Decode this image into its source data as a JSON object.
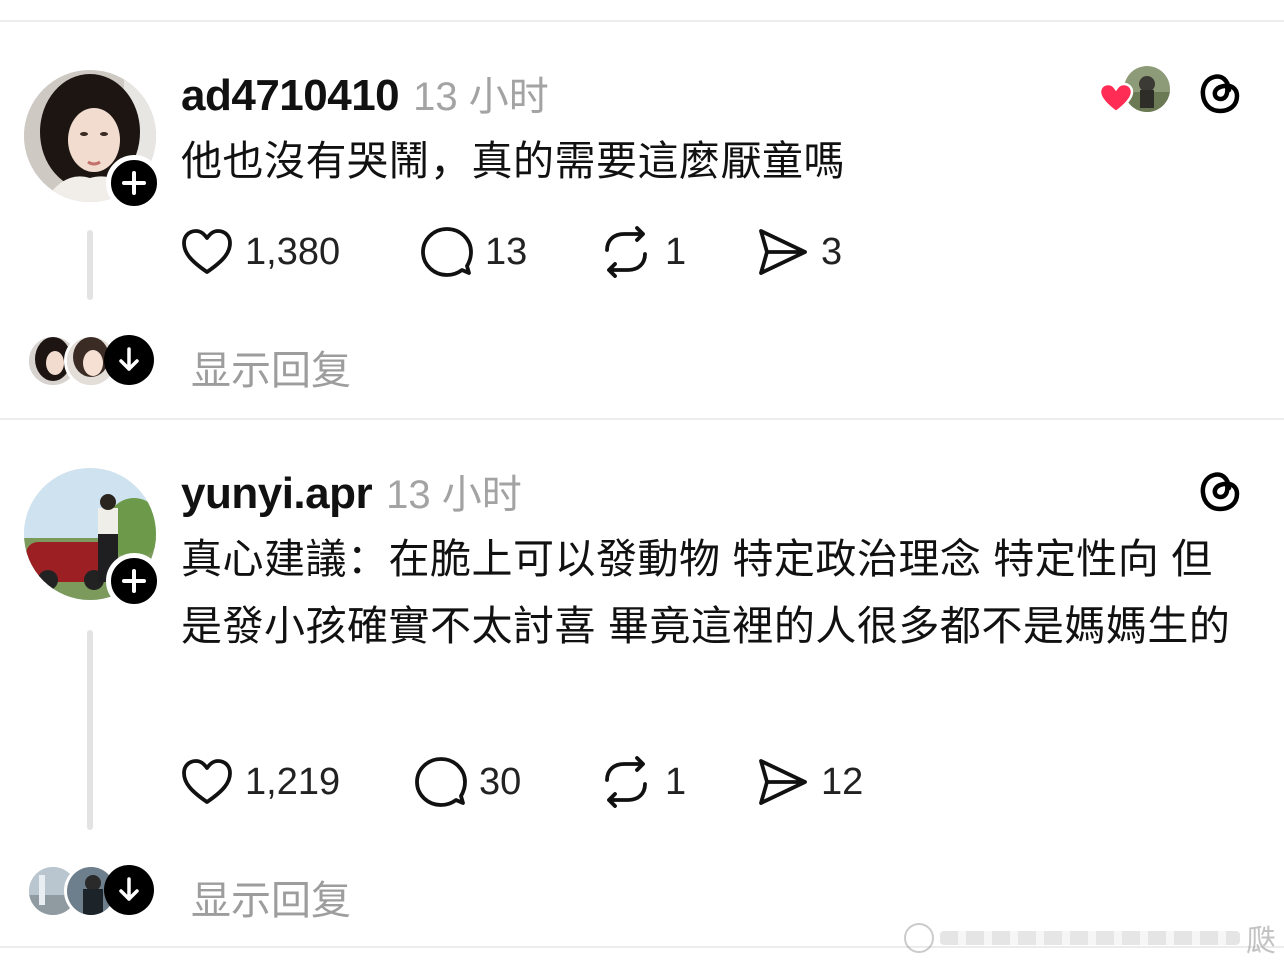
{
  "posts": [
    {
      "username": "ad4710410",
      "time": "13 小时",
      "text": "他也沒有哭鬧，真的需要這麼厭童嗎",
      "likes": "1,380",
      "comments": "13",
      "reposts": "1",
      "shares": "3",
      "show_replies": "显示回复",
      "liked_by_author": true
    },
    {
      "username": "yunyi.apr",
      "time": "13 小时",
      "text": "真心建議：在脆上可以發動物 特定政治理念 特定性向 但是發小孩確實不太討喜 畢竟這裡的人很多都不是媽媽生的",
      "likes": "1,219",
      "comments": "30",
      "reposts": "1",
      "shares": "12",
      "show_replies": "显示回复",
      "liked_by_author": false
    }
  ],
  "icons": {
    "like": "heart-outline-icon",
    "comment": "speech-bubble-icon",
    "repost": "repost-arrows-icon",
    "share": "paper-plane-icon",
    "app": "threads-logo-icon",
    "follow": "plus-icon",
    "expand": "arrow-down-icon"
  },
  "colors": {
    "accent_heart": "#ff2d55",
    "muted_text": "#a3a3a3",
    "divider": "#ececec"
  }
}
